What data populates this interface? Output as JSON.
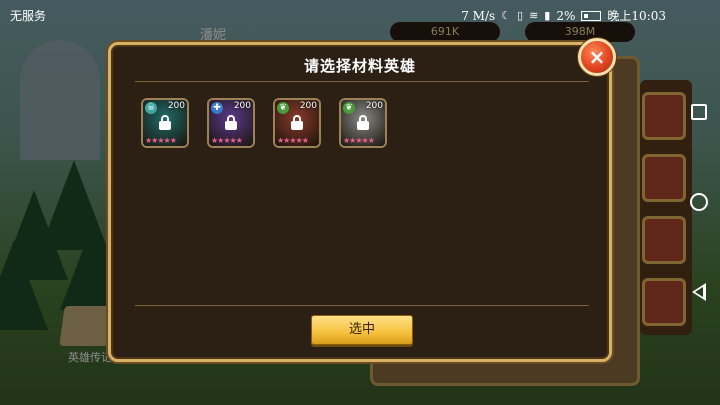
{
  "status_bar": {
    "carrier": "无服务",
    "speed": "7 M/s",
    "battery": "2%",
    "time": "晚上10:03"
  },
  "background": {
    "hero_name": "潘妮",
    "resource_1": "691K",
    "resource_2": "398M",
    "book_label": "英雄传记"
  },
  "dialog": {
    "title": "请选择材料英雄",
    "close_label": "×",
    "select_button_label": "选中",
    "heroes": [
      {
        "level": "200",
        "element": "skull",
        "element_glyph": "☠",
        "element_color": "#3fa6a0",
        "art_color": "#1f6b6a",
        "stars": "★★★★★",
        "locked": true
      },
      {
        "level": "200",
        "element": "cross",
        "element_glyph": "✚",
        "element_color": "#3a78c8",
        "art_color": "#5b3a8c",
        "stars": "★★★★★",
        "locked": true
      },
      {
        "level": "200",
        "element": "leaf",
        "element_glyph": "❦",
        "element_color": "#4a9a3a",
        "art_color": "#8a3a2a",
        "stars": "★★★★★",
        "locked": true
      },
      {
        "level": "200",
        "element": "leaf",
        "element_glyph": "❦",
        "element_color": "#4a9a3a",
        "art_color": "#8a8a88",
        "stars": "★★★★★",
        "locked": true
      }
    ]
  },
  "colors": {
    "dialog_bg": "#2c2014",
    "dialog_border": "#d7b264",
    "button_gold": "#f5c13d",
    "close_red": "#e0451f"
  }
}
